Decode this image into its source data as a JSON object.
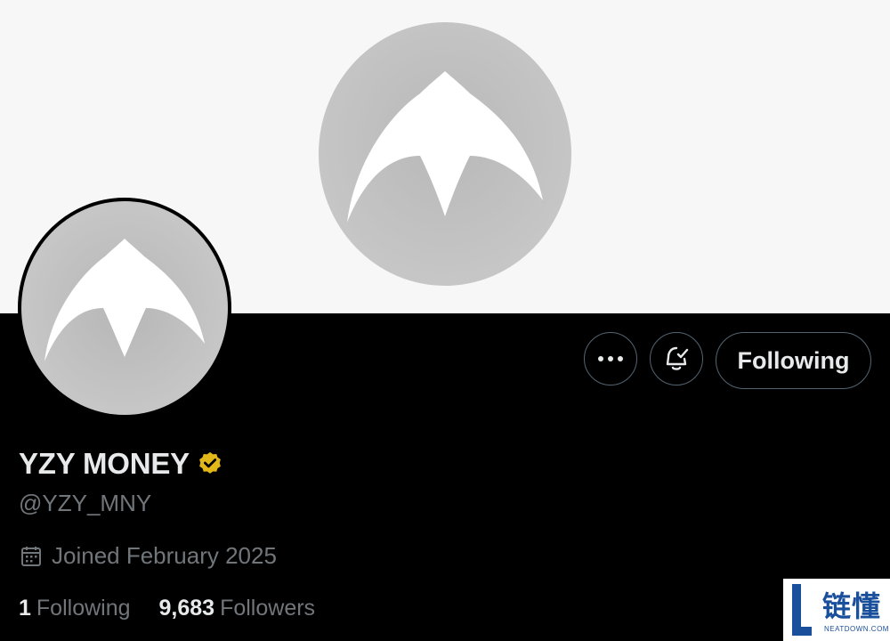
{
  "profile": {
    "display_name": "YZY MONEY",
    "handle": "@YZY_MNY",
    "joined": "Joined February 2025",
    "following_count": "1",
    "following_label": "Following",
    "followers_count": "9,683",
    "followers_label": "Followers"
  },
  "actions": {
    "follow_state_label": "Following"
  },
  "icons": {
    "more": "more-horizontal-icon",
    "notify": "bell-check-icon",
    "verified": "verified-badge-icon",
    "calendar": "calendar-icon"
  },
  "colors": {
    "background": "#000000",
    "banner": "#f7f7f7",
    "verified_gold": "#e2b719",
    "secondary_text": "#71767b"
  },
  "watermark": {
    "text": "链懂",
    "sub": "NEATDOWN.COM"
  }
}
